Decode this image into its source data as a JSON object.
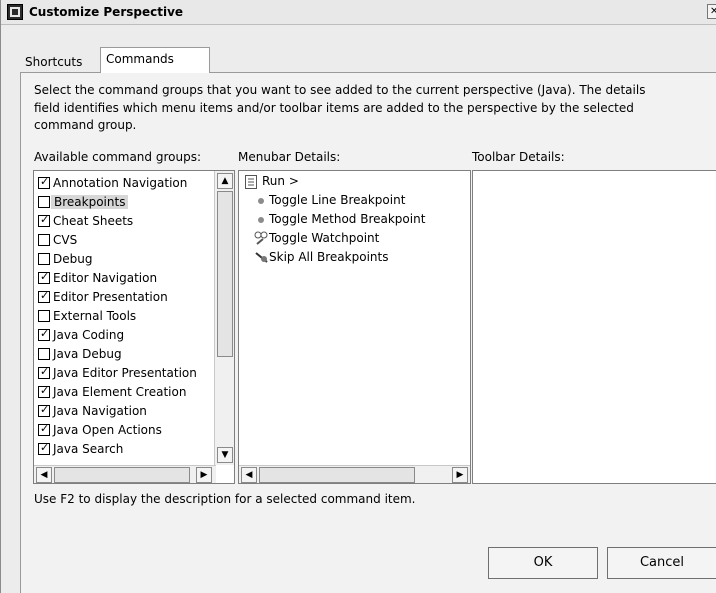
{
  "window": {
    "title": "Customize Perspective"
  },
  "tabs": [
    {
      "label": "Shortcuts",
      "active": false
    },
    {
      "label": "Commands",
      "active": true
    }
  ],
  "description": [
    "Select the command groups that you want to see added to the current perspective (Java).  The details",
    "field identifies which menu items and/or toolbar items are added to the perspective by the selected",
    "command group."
  ],
  "columns": {
    "available": "Available command groups:",
    "menubar": "Menubar Details:",
    "toolbar": "Toolbar Details:"
  },
  "command_groups": [
    {
      "label": "Annotation Navigation",
      "checked": true,
      "selected": false
    },
    {
      "label": "Breakpoints",
      "checked": false,
      "selected": true
    },
    {
      "label": "Cheat Sheets",
      "checked": true,
      "selected": false
    },
    {
      "label": "CVS",
      "checked": false,
      "selected": false
    },
    {
      "label": "Debug",
      "checked": false,
      "selected": false
    },
    {
      "label": "Editor Navigation",
      "checked": true,
      "selected": false
    },
    {
      "label": "Editor Presentation",
      "checked": true,
      "selected": false
    },
    {
      "label": "External Tools",
      "checked": false,
      "selected": false
    },
    {
      "label": "Java Coding",
      "checked": true,
      "selected": false
    },
    {
      "label": "Java Debug",
      "checked": false,
      "selected": false
    },
    {
      "label": "Java Editor Presentation",
      "checked": true,
      "selected": false
    },
    {
      "label": "Java Element Creation",
      "checked": true,
      "selected": false
    },
    {
      "label": "Java Navigation",
      "checked": true,
      "selected": false
    },
    {
      "label": "Java Open Actions",
      "checked": true,
      "selected": false
    },
    {
      "label": "Java Search",
      "checked": true,
      "selected": false
    }
  ],
  "menubar_details": {
    "root": "Run  >",
    "items": [
      {
        "label": "Toggle Line Breakpoint",
        "icon": "bullet-icon"
      },
      {
        "label": "Toggle Method Breakpoint",
        "icon": "bullet-icon"
      },
      {
        "label": "Toggle Watchpoint",
        "icon": "watchpoint-icon"
      },
      {
        "label": "Skip All Breakpoints",
        "icon": "skip-breakpoints-icon"
      }
    ]
  },
  "hint": "Use F2 to display the description for a selected command item.",
  "buttons": {
    "ok": "OK",
    "cancel": "Cancel"
  }
}
